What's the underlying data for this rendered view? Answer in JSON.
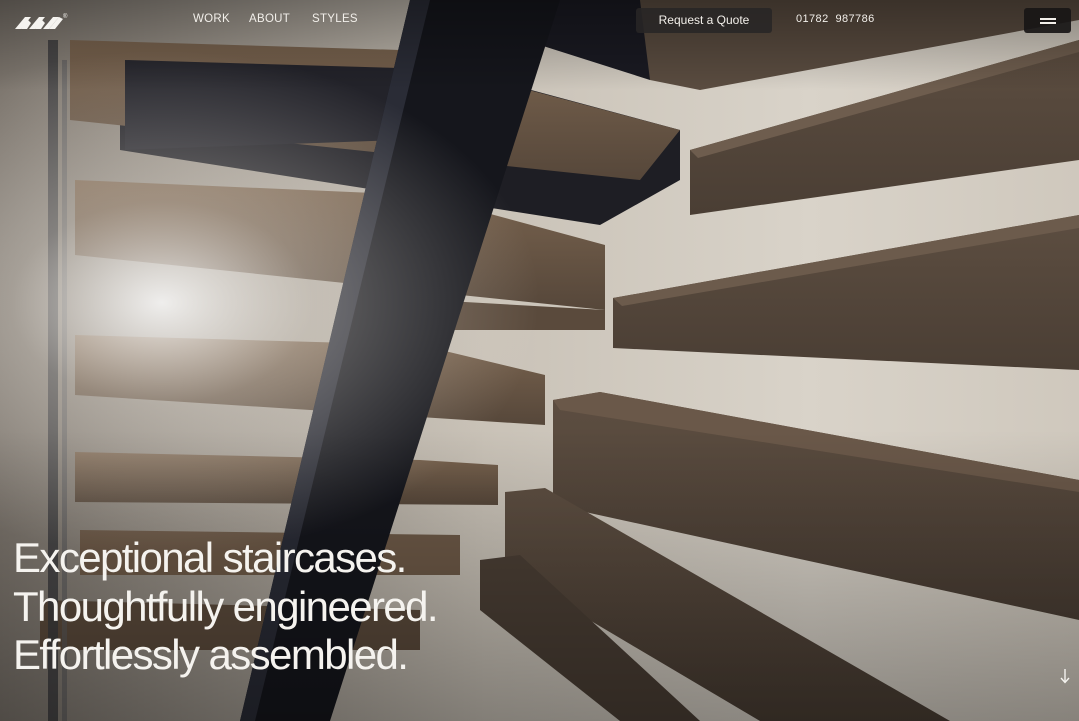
{
  "brand": {
    "logo_icon": "stair-chevrons-logo-icon",
    "registered_mark": "®"
  },
  "nav": {
    "links": [
      {
        "label": "WORK"
      },
      {
        "label": "ABOUT"
      },
      {
        "label": "STYLES"
      }
    ],
    "quote_button": "Request a Quote",
    "phone": "01782  987786",
    "menu_icon": "hamburger-menu-icon"
  },
  "hero": {
    "headline_lines": [
      "Exceptional staircases.",
      "Thoughtfully engineered.",
      "Effortlessly assembled."
    ],
    "scroll_icon": "arrow-down-icon",
    "scroll_glyph": "↓"
  },
  "colors": {
    "text": "#f5f3ef",
    "button_bg": "#282626",
    "wall": "#d8d2c8",
    "tread": "#6e5a47",
    "stringer": "#15161c"
  }
}
